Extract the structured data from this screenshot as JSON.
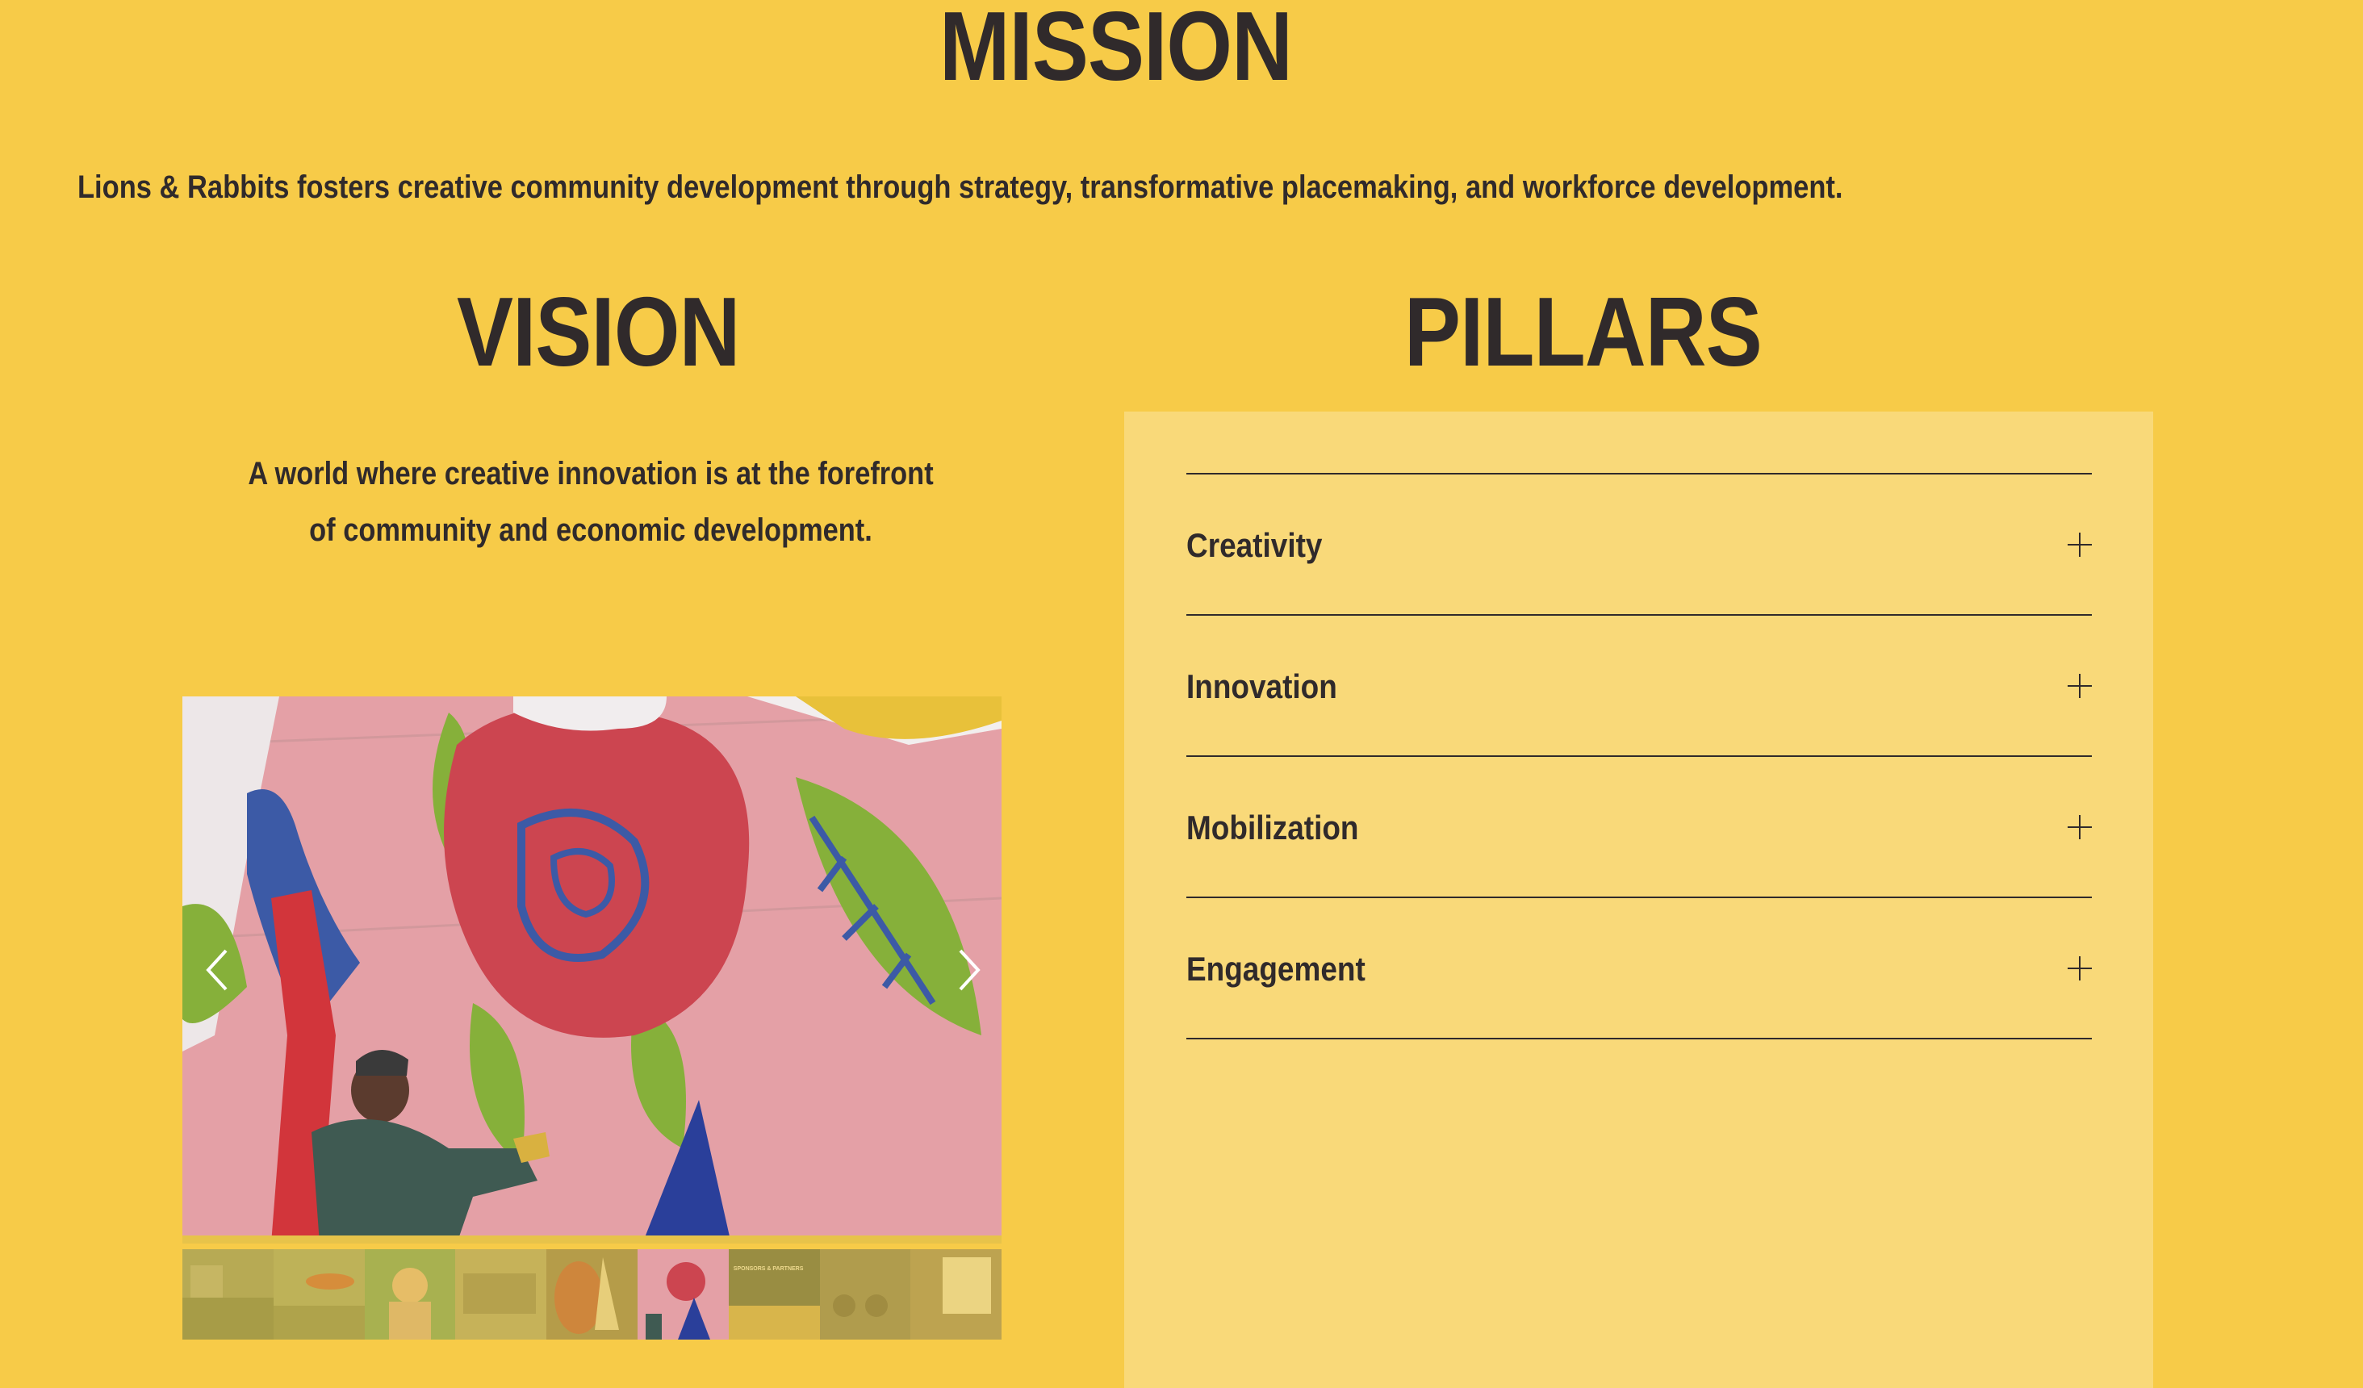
{
  "mission": {
    "title": "MISSION",
    "statement": "Lions & Rabbits fosters creative community development through strategy, transformative placemaking, and workforce development."
  },
  "vision": {
    "title": "VISION",
    "statement_lines": [
      "A world where creative innovation is at the forefront",
      "of community and economic development."
    ]
  },
  "pillars": {
    "title": "PILLARS",
    "items": [
      {
        "label": "Creativity"
      },
      {
        "label": "Innovation"
      },
      {
        "label": "Mobilization"
      },
      {
        "label": "Engagement"
      }
    ]
  },
  "carousel": {
    "prev_icon": "chevron-left-icon",
    "next_icon": "chevron-right-icon",
    "thumbnail_count": 9,
    "active_thumbnail": 6,
    "thumbnail_captions": {
      "7": "SPONSORS & PARTNERS"
    }
  },
  "colors": {
    "background": "#F7CB48",
    "panel": "#F9D979",
    "text": "#302A2B"
  }
}
